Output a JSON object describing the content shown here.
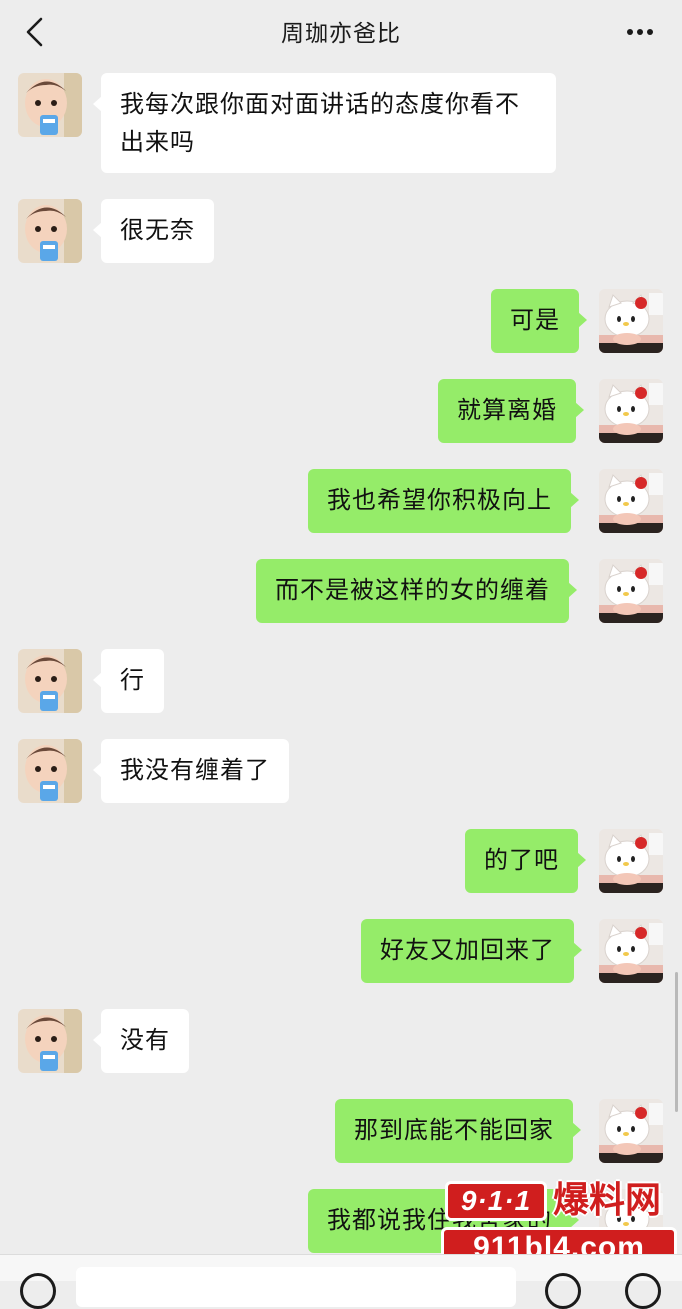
{
  "header": {
    "title": "周珈亦爸比",
    "back_icon": "chevron-left-icon",
    "more_icon": "more-dots-icon"
  },
  "conversation": [
    {
      "side": "left",
      "text": "我每次跟你面对面讲话的态度你看不出来吗"
    },
    {
      "side": "left",
      "text": "很无奈"
    },
    {
      "side": "right",
      "text": "可是"
    },
    {
      "side": "right",
      "text": "就算离婚"
    },
    {
      "side": "right",
      "text": "我也希望你积极向上"
    },
    {
      "side": "right",
      "text": "而不是被这样的女的缠着"
    },
    {
      "side": "left",
      "text": "行"
    },
    {
      "side": "left",
      "text": "我没有缠着了"
    },
    {
      "side": "right",
      "text": "的了吧"
    },
    {
      "side": "right",
      "text": "好友又加回来了"
    },
    {
      "side": "left",
      "text": "没有"
    },
    {
      "side": "right",
      "text": "那到底能不能回家"
    },
    {
      "side": "right",
      "text": "我都说我住我舍家的"
    }
  ],
  "watermark": {
    "badge": "9·1·1",
    "name": "爆料网",
    "url": "911bl4.com"
  },
  "input_bar": {
    "voice_icon": "voice-icon",
    "emoji_icon": "emoji-icon",
    "plus_icon": "plus-icon"
  },
  "colors": {
    "background": "#ededed",
    "incoming_bubble": "#ffffff",
    "outgoing_bubble": "#95ec69",
    "watermark_red": "#d01e1e"
  }
}
